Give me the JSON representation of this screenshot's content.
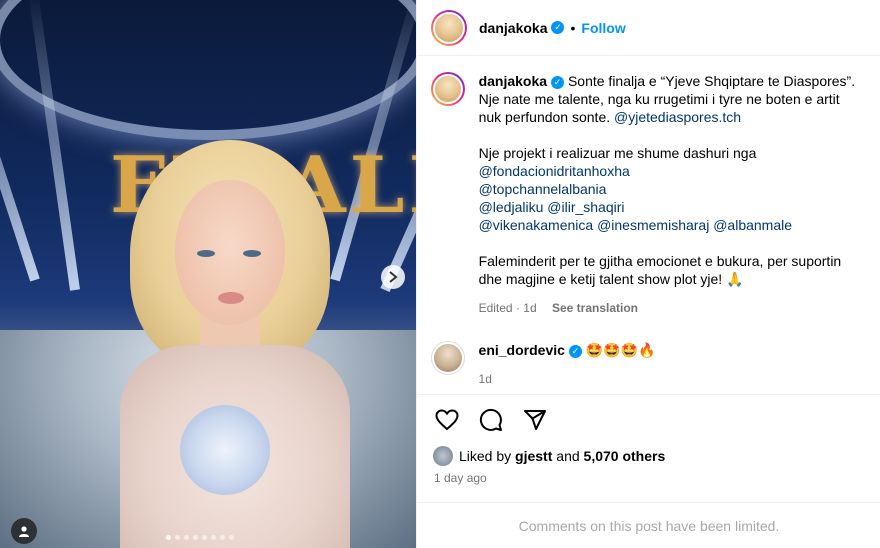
{
  "post_header": {
    "username": "danjakoka",
    "separator": "•",
    "follow_label": "Follow"
  },
  "caption": {
    "username": "danjakoka",
    "line1": "Sonte finalja e “Yjeve Shqiptare te Diaspores”.",
    "line2": "Nje nate me talente, nga ku rrugetimi i tyre ne boten e artit nuk perfundon sonte.",
    "mention1": "@yjetediaspores.tch",
    "para2_text": "Nje projekt i realizuar me shume dashuri nga",
    "mention_fondacion": "@fondacionidritanhoxha",
    "mention_topchannel": "@topchannelalbania",
    "mention_ledjaliku": "@ledjaliku",
    "mention_ilir": "@ilir_shaqiri",
    "mention_vikena": "@vikenakamenica",
    "mention_ines": "@inesmemisharaj",
    "mention_alban": "@albanmale",
    "para3_text": "Faleminderit per te gjitha emocionet e bukura, per suportin dhe magjine e ketij talent show plot yje!",
    "para3_emoji": "🙏",
    "edited": "Edited · 1d",
    "see_translation": "See translation"
  },
  "comment": {
    "username": "eni_dordevic",
    "text": "🤩🤩🤩🔥",
    "time": "1d"
  },
  "likes": {
    "liked_by": "Liked by",
    "user": "gjestt",
    "and": "and",
    "others": "5,070 others"
  },
  "post_date": "1 day ago",
  "comments_limited": "Comments on this post have been limited.",
  "media": {
    "overlay_text": "FINALE",
    "carousel_dots": 8,
    "active_dot": 0
  },
  "icons": [
    "heart-icon",
    "comment-icon",
    "share-icon",
    "chevron-right-icon",
    "user-tag-icon",
    "verified-icon"
  ],
  "colors": {
    "accent": "#0095f6",
    "link": "#00376b",
    "muted": "#737373"
  }
}
